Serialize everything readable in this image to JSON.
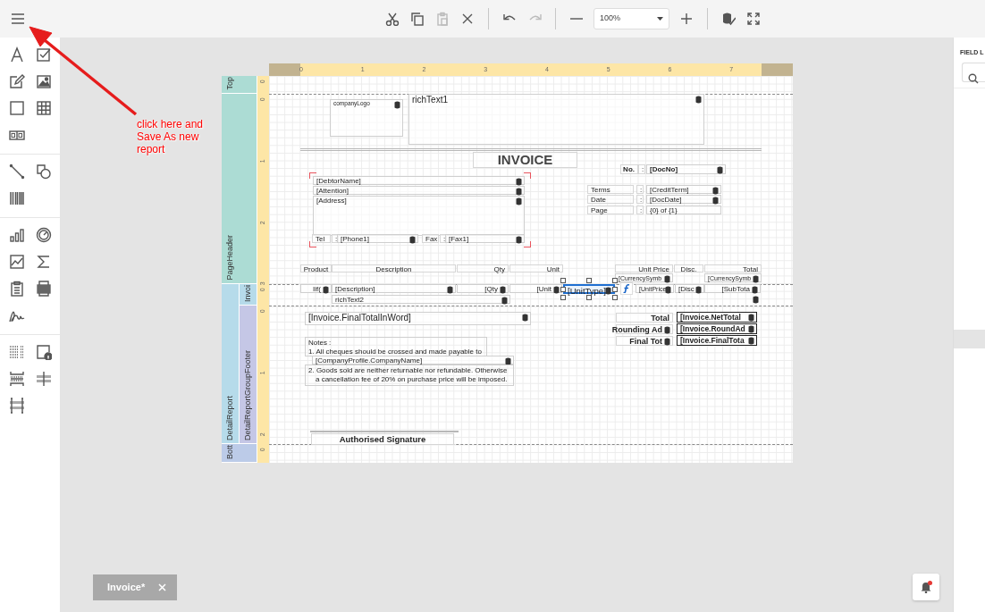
{
  "toolbar_groups": [
    [
      {
        "kind": "cut",
        "disabled": false
      },
      {
        "kind": "copy",
        "disabled": false
      },
      {
        "kind": "paste",
        "disabled": true
      },
      {
        "kind": "delete",
        "disabled": false
      }
    ],
    [
      {
        "kind": "undo",
        "disabled": false
      },
      {
        "kind": "redo",
        "disabled": true
      }
    ],
    [
      {
        "kind": "zoom-out",
        "disabled": false
      },
      {
        "kind": "combo",
        "value": "100%",
        "disabled": false
      },
      {
        "kind": "zoom-in",
        "disabled": false
      }
    ],
    [
      {
        "kind": "validate",
        "disabled": false
      },
      {
        "kind": "fullscreen",
        "disabled": false
      }
    ]
  ],
  "annotation": {
    "text": "click here and Save As new report"
  },
  "ruler": {
    "ticks": [
      "0",
      "1",
      "2",
      "3",
      "4",
      "5",
      "6",
      "7"
    ]
  },
  "bands": [
    {
      "name": "Top",
      "ruler_ticks": [
        "0"
      ]
    },
    {
      "name": "PageHeader",
      "ruler_ticks": [
        "0",
        "1",
        "2",
        "3"
      ]
    },
    {
      "name": "DetailReport",
      "children": [
        {
          "name": "Invoi",
          "ruler_ticks": [
            "0"
          ]
        },
        {
          "name": "DetailReportGroupFooter",
          "ruler_ticks": [
            "0",
            "1",
            "2"
          ]
        }
      ]
    },
    {
      "name": "Bott",
      "ruler_ticks": [
        "0"
      ]
    }
  ],
  "controls": [
    {
      "kind": "picture",
      "text": "companyLogo",
      "bound": true,
      "selected": false
    },
    {
      "kind": "rich",
      "text": "richText1",
      "bound": true,
      "selected": false
    },
    {
      "kind": "label",
      "text": "INVOICE",
      "bold": true,
      "bound": false,
      "selected": false
    },
    {
      "kind": "label",
      "text": "No.",
      "bold": true,
      "bound": false,
      "selected": false
    },
    {
      "kind": "label",
      "text": ":",
      "bound": false,
      "selected": false
    },
    {
      "kind": "field",
      "text": "[DocNo]",
      "bold": true,
      "bound": true,
      "selected": false
    },
    {
      "kind": "field",
      "text": "[DebtorName]",
      "bound": true,
      "selected": false
    },
    {
      "kind": "field",
      "text": "[Attention]",
      "bound": true,
      "selected": false
    },
    {
      "kind": "field",
      "text": "[Address]",
      "bound": true,
      "selected": false
    },
    {
      "kind": "label",
      "text": "Terms",
      "bound": false,
      "selected": false
    },
    {
      "kind": "label",
      "text": ":",
      "bound": false,
      "selected": false
    },
    {
      "kind": "field",
      "text": "[CreditTerm]",
      "bound": true,
      "selected": false
    },
    {
      "kind": "label",
      "text": "Date",
      "bound": false,
      "selected": false
    },
    {
      "kind": "label",
      "text": ":",
      "bound": false,
      "selected": false
    },
    {
      "kind": "field",
      "text": "[DocDate]",
      "bound": true,
      "selected": false
    },
    {
      "kind": "label",
      "text": "Page",
      "bound": false,
      "selected": false
    },
    {
      "kind": "label",
      "text": ":",
      "bound": false,
      "selected": false
    },
    {
      "kind": "field",
      "text": "{0} of {1}",
      "bound": false,
      "selected": false
    },
    {
      "kind": "label",
      "text": "Tel",
      "bound": false,
      "selected": false
    },
    {
      "kind": "label",
      "text": ":",
      "bound": false,
      "selected": false
    },
    {
      "kind": "field",
      "text": "[Phone1]",
      "bound": true,
      "selected": false
    },
    {
      "kind": "label",
      "text": "Fax",
      "bound": false,
      "selected": false
    },
    {
      "kind": "label",
      "text": ":",
      "bound": false,
      "selected": false
    },
    {
      "kind": "field",
      "text": "[Fax1]",
      "bound": true,
      "selected": false
    },
    {
      "kind": "label",
      "text": "Product",
      "bound": false,
      "selected": false
    },
    {
      "kind": "label",
      "text": "Description",
      "bound": false,
      "selected": false
    },
    {
      "kind": "label",
      "text": "Qty",
      "bound": false,
      "selected": false
    },
    {
      "kind": "label",
      "text": "Unit",
      "bound": false,
      "selected": false
    },
    {
      "kind": "label",
      "text": "Unit Price",
      "bound": false,
      "selected": false
    },
    {
      "kind": "label",
      "text": "Disc.",
      "bound": false,
      "selected": false
    },
    {
      "kind": "label",
      "text": "Total",
      "bound": false,
      "selected": false
    },
    {
      "kind": "field",
      "text": "[CurrencySymb",
      "bound": true,
      "selected": false
    },
    {
      "kind": "field",
      "text": "[CurrencySymb",
      "bound": true,
      "selected": false
    },
    {
      "kind": "field",
      "text": "Iif(",
      "bound": true,
      "selected": false
    },
    {
      "kind": "field",
      "text": "[Description]",
      "bound": true,
      "selected": false
    },
    {
      "kind": "field",
      "text": "[Qty",
      "bound": true,
      "selected": false
    },
    {
      "kind": "field",
      "text": "[Unit",
      "bound": true,
      "selected": false
    },
    {
      "kind": "field",
      "text": "[UnitType]",
      "bound": true,
      "selected": true
    },
    {
      "kind": "field",
      "text": "[UnitPrice",
      "bound": true,
      "selected": false
    },
    {
      "kind": "field",
      "text": "[Disc",
      "bound": true,
      "selected": false
    },
    {
      "kind": "field",
      "text": "[SubTota",
      "bound": true,
      "selected": false
    },
    {
      "kind": "rich",
      "text": "richText2",
      "bound": true,
      "selected": false
    },
    {
      "kind": "blank",
      "bound": true
    },
    {
      "kind": "field",
      "text": "[Invoice.FinalTotalInWord]",
      "bound": true,
      "selected": false
    },
    {
      "kind": "label",
      "text": "Total",
      "bold": true,
      "bound": false,
      "selected": false
    },
    {
      "kind": "field",
      "text": "[Invoice.NetTotal",
      "bold": true,
      "bound": true,
      "selected": false
    },
    {
      "kind": "label",
      "text": "Rounding Ad",
      "bold": true,
      "bound": true,
      "selected": false
    },
    {
      "kind": "field",
      "text": "[Invoice.RoundAd",
      "bold": true,
      "bound": true,
      "selected": false
    },
    {
      "kind": "label",
      "text": "Final Tot",
      "bold": true,
      "bound": true,
      "selected": false
    },
    {
      "kind": "field",
      "text": "[Invoice.FinalTota",
      "bold": true,
      "bound": true,
      "selected": false
    },
    {
      "kind": "note",
      "lines": [
        "Notes :",
        "1. All cheques should be crossed and made payable to"
      ],
      "selected": false
    },
    {
      "kind": "field",
      "text": "[CompanyProfile.CompanyName]",
      "bound": true,
      "selected": false
    },
    {
      "kind": "note",
      "lines": [
        "2. Goods sold are neither returnable nor refundable. Otherwise",
        "a cancellation fee of 20% on purchase price will be imposed."
      ],
      "selected": false
    },
    {
      "kind": "label",
      "text": "Authorised Signature",
      "bold": true,
      "bound": false,
      "selected": false
    }
  ],
  "field_list": {
    "title": "FIELD L"
  },
  "document_tabs": [
    {
      "label": "Invoice*",
      "selected": true
    }
  ],
  "notifications": {
    "unread": true
  }
}
